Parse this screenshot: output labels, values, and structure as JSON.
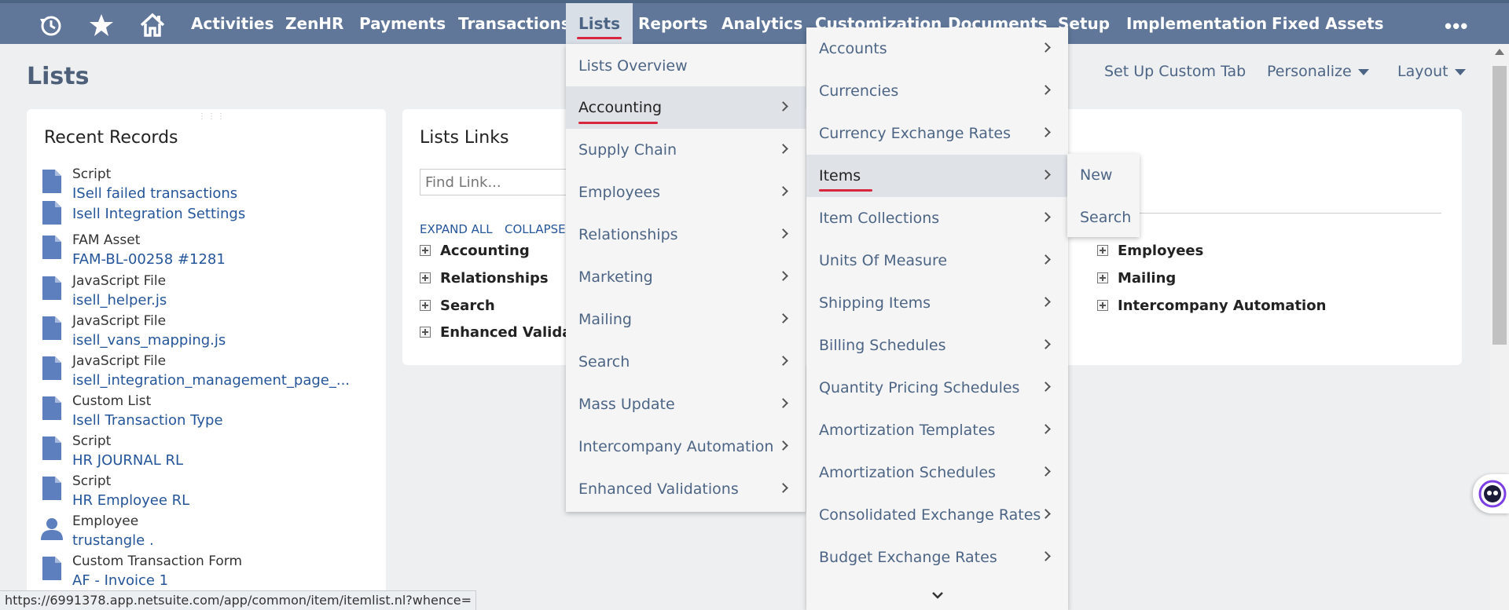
{
  "topbar": {
    "icons": [
      "recent-history-icon",
      "star-icon",
      "home-icon"
    ],
    "nav": [
      "Activities",
      "ZenHR",
      "Payments",
      "Transactions",
      "Lists",
      "Reports",
      "Analytics",
      "Customization",
      "Documents",
      "Setup",
      "Implementation",
      "Fixed Assets"
    ],
    "active": "Lists",
    "more_label": "•••",
    "colors": {
      "bar": "#607799",
      "active_bg": "#d9dfe7",
      "accent": "#d7263d"
    }
  },
  "page": {
    "title": "Lists",
    "actions": {
      "custom_tab": "Set Up Custom Tab",
      "personalize": "Personalize",
      "layout": "Layout"
    }
  },
  "recent_records": {
    "title": "Recent Records",
    "items": [
      {
        "type": "Script",
        "name": "ISell failed transactions",
        "icon": "document-icon"
      },
      {
        "type": "",
        "name": "Isell Integration Settings",
        "icon": "document-icon"
      },
      {
        "type": "FAM Asset",
        "name": "FAM-BL-00258 #1281",
        "icon": "document-icon"
      },
      {
        "type": "JavaScript File",
        "name": "isell_helper.js",
        "icon": "document-icon"
      },
      {
        "type": "JavaScript File",
        "name": "isell_vans_mapping.js",
        "icon": "document-icon"
      },
      {
        "type": "JavaScript File",
        "name": "isell_integration_management_page_...",
        "icon": "document-icon"
      },
      {
        "type": "Custom List",
        "name": "Isell Transaction Type",
        "icon": "document-icon"
      },
      {
        "type": "Script",
        "name": "HR JOURNAL RL",
        "icon": "document-icon"
      },
      {
        "type": "Script",
        "name": "HR Employee RL",
        "icon": "document-icon"
      },
      {
        "type": "Employee",
        "name": "trustangle .",
        "icon": "person-icon"
      },
      {
        "type": "Custom Transaction Form",
        "name": "AF - Invoice 1",
        "icon": "document-icon"
      }
    ]
  },
  "lists_links": {
    "title": "Lists Links",
    "search_placeholder": "Find Link...",
    "expand_all": "EXPAND ALL",
    "collapse_all": "COLLAPSE ALL",
    "left_items": [
      "Accounting",
      "Relationships",
      "Search",
      "Enhanced Validations"
    ],
    "right_items": [
      "Employees",
      "Mailing",
      "Intercompany Automation"
    ]
  },
  "menu_lists": {
    "items": [
      {
        "label": "Lists Overview",
        "sub": false
      },
      {
        "label": "Accounting",
        "sub": true
      },
      {
        "label": "Supply Chain",
        "sub": true
      },
      {
        "label": "Employees",
        "sub": true
      },
      {
        "label": "Relationships",
        "sub": true
      },
      {
        "label": "Marketing",
        "sub": true
      },
      {
        "label": "Mailing",
        "sub": true
      },
      {
        "label": "Search",
        "sub": true
      },
      {
        "label": "Mass Update",
        "sub": true
      },
      {
        "label": "Intercompany Automation",
        "sub": true
      },
      {
        "label": "Enhanced Validations",
        "sub": true
      }
    ],
    "highlighted": "Accounting"
  },
  "menu_accounting": {
    "items": [
      "Accounts",
      "Currencies",
      "Currency Exchange Rates",
      "Items",
      "Item Collections",
      "Units Of Measure",
      "Shipping Items",
      "Billing Schedules",
      "Quantity Pricing Schedules",
      "Amortization Templates",
      "Amortization Schedules",
      "Consolidated Exchange Rates",
      "Budget Exchange Rates"
    ],
    "highlighted": "Items"
  },
  "menu_items": {
    "items": [
      "New",
      "Search"
    ]
  },
  "status_bar": {
    "url": "https://6991378.app.netsuite.com/app/common/item/itemlist.nl?whence="
  }
}
